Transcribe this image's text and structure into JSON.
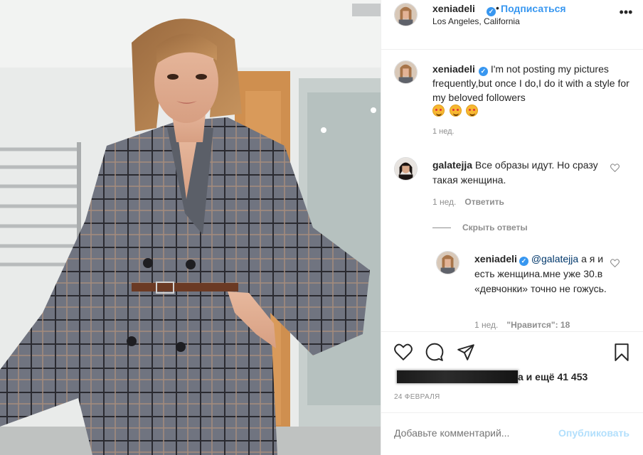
{
  "header": {
    "username": "xeniadeli",
    "separator": "•",
    "follow_label": "Подписаться",
    "location": "Los Angeles, California",
    "more_icon": "more-horizontal-icon"
  },
  "caption": {
    "username": "xeniadeli",
    "text": "I'm not posting my pictures frequently,but once I do,I do it with a style for my beloved followers",
    "emojis": [
      "smiling-face-with-hearts",
      "smiling-face-with-hearts",
      "smiling-face-with-hearts"
    ],
    "time": "1 нед."
  },
  "comments": [
    {
      "username": "galatejja",
      "text": "Все образы идут. Но сразу такая женщина.",
      "time": "1 нед.",
      "reply_label": "Ответить"
    }
  ],
  "hide_replies_label": "Скрыть ответы",
  "replies": [
    {
      "username": "xeniadeli",
      "mention": "@galatejja",
      "text": " а я и есть женщина.мне уже 30.в «девчонки» точно не гожусь.",
      "time": "1 нед.",
      "likes_label": "\"Нравится\": 18"
    }
  ],
  "actions": {
    "like_icon": "heart-icon",
    "comment_icon": "comment-icon",
    "share_icon": "paper-plane-icon",
    "save_icon": "bookmark-icon"
  },
  "likes_suffix": "а и ещё 41 453",
  "post_date": "24 ФЕВРАЛЯ",
  "add_comment": {
    "placeholder": "Добавьте комментарий...",
    "publish_label": "Опубликовать"
  },
  "colors": {
    "link_blue": "#3897f0",
    "publish_disabled": "#b2dffc",
    "secondary_text": "#8e8e8e"
  }
}
